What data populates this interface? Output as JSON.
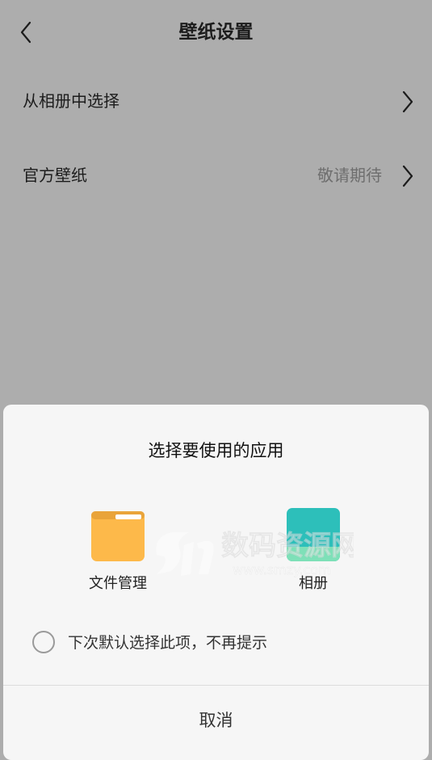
{
  "header": {
    "title": "壁纸设置",
    "back_icon": "chevron-left-icon"
  },
  "settings": {
    "rows": [
      {
        "label": "从相册中选择",
        "value": "",
        "icon": "chevron-right-icon"
      },
      {
        "label": "官方壁纸",
        "value": "敬请期待",
        "icon": "chevron-right-icon"
      }
    ]
  },
  "chooser": {
    "title": "选择要使用的应用",
    "apps": [
      {
        "label": "文件管理",
        "icon": "folder-icon",
        "color": "#FDB94A"
      },
      {
        "label": "相册",
        "icon": "gallery-icon",
        "color": "#2DBFBA"
      }
    ],
    "remember_label": "下次默认选择此项，不再提示",
    "remember_checked": false,
    "cancel_label": "取消"
  },
  "watermark": {
    "text": "数码资源网",
    "subtext": "www.smzy.com"
  },
  "colors": {
    "dim_background": "#ADADAD",
    "sheet_background": "#F6F6F6",
    "secondary_text": "#6E6E6E"
  }
}
